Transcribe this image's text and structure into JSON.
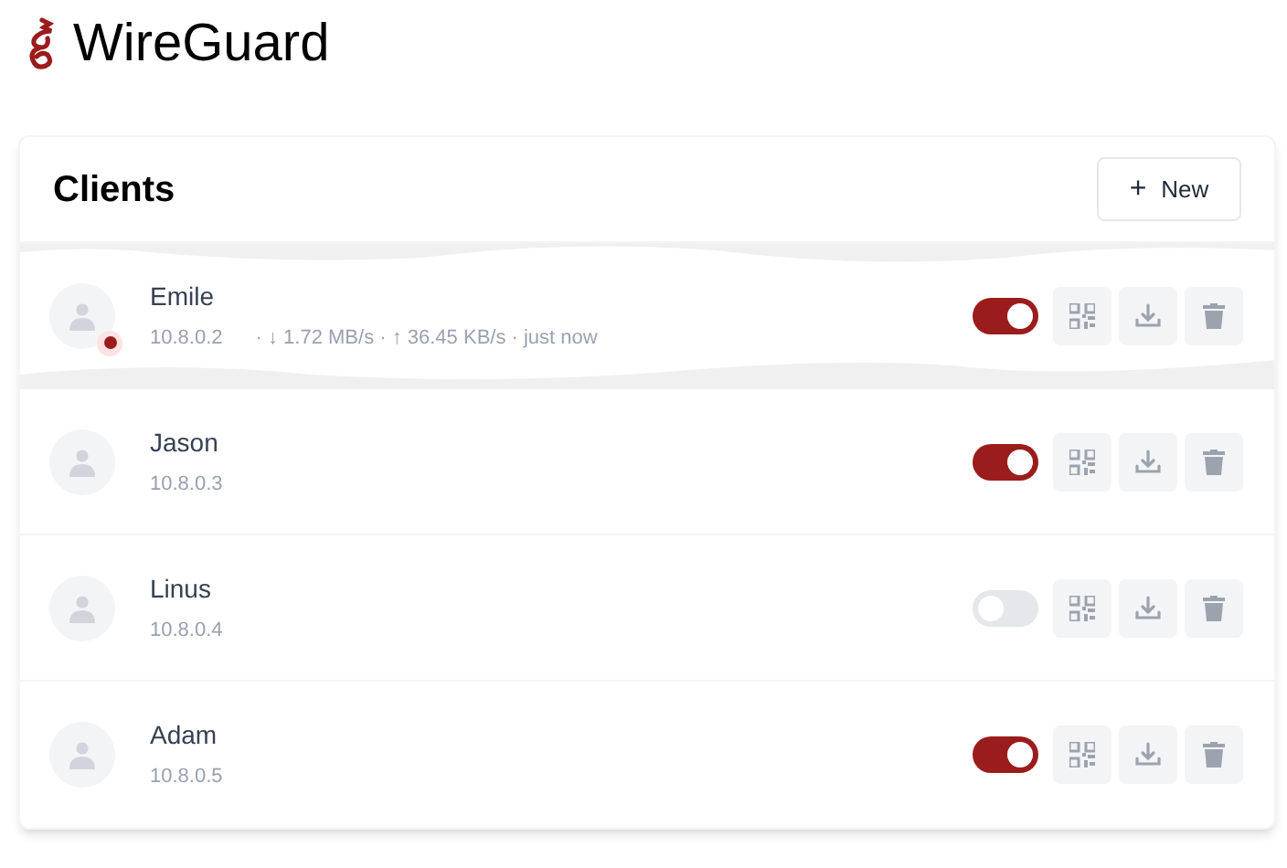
{
  "app": {
    "title": "WireGuard"
  },
  "panel": {
    "title": "Clients",
    "new_button": {
      "icon": "+",
      "label": "New"
    }
  },
  "clients": [
    {
      "name": "Emile",
      "address": "10.8.0.2",
      "connected": true,
      "stats": "· ↓ 1.72 MB/s · ↑ 36.45 KB/s · just now",
      "enabled": true
    },
    {
      "name": "Jason",
      "address": "10.8.0.3",
      "connected": false,
      "enabled": true
    },
    {
      "name": "Linus",
      "address": "10.8.0.4",
      "connected": false,
      "enabled": false
    },
    {
      "name": "Adam",
      "address": "10.8.0.5",
      "connected": false,
      "enabled": true
    }
  ]
}
